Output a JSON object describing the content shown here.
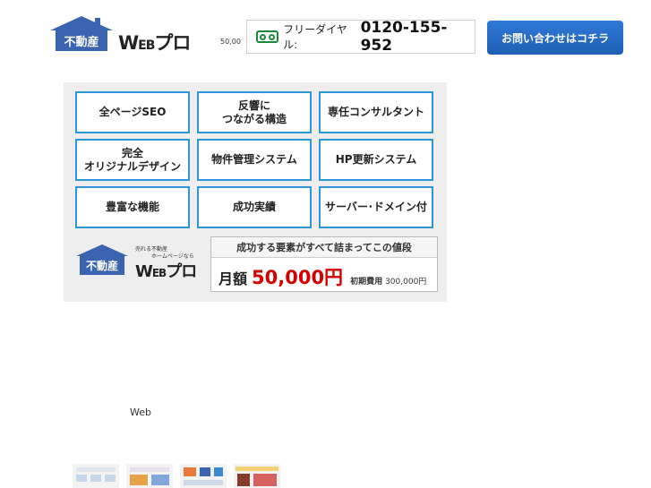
{
  "header": {
    "logo": {
      "house_text": "不動産",
      "brand_main": "W",
      "brand_small": "EB",
      "brand_suffix": "プロ"
    },
    "price_snippet": "50,00",
    "freedial": {
      "label": "フリーダイヤル:",
      "number": "0120-155-952",
      "icon": "freedial-icon"
    },
    "contact_button": "お問い合わせはコチラ"
  },
  "banner": {
    "features": [
      [
        "全ページSEO"
      ],
      [
        "反響に",
        "つながる構造"
      ],
      [
        "専任コンサルタント"
      ],
      [
        "完全",
        "オリジナルデザイン"
      ],
      [
        "物件管理システム"
      ],
      [
        "HP更新システム"
      ],
      [
        "豊富な機能"
      ],
      [
        "成功実績"
      ],
      [
        "サーバー･ドメイン付"
      ]
    ],
    "logo": {
      "tagline_1": "売れる不動産",
      "tagline_2": "ホームページなら",
      "house_text": "不動産",
      "brand_main": "W",
      "brand_small": "EB",
      "brand_suffix": "プロ"
    },
    "price": {
      "headline": "成功する要素がすべて詰まってこの値段",
      "monthly_label": "月額",
      "monthly_amount": "50,000円",
      "initial_label": "初期費用",
      "initial_amount": "300,000円"
    }
  },
  "body": {
    "web_text": "Web"
  },
  "colors": {
    "accent_blue": "#2b97d6",
    "logo_blue": "#3a63b0",
    "price_red": "#d40000",
    "freedial_green": "#1a8a3a"
  }
}
